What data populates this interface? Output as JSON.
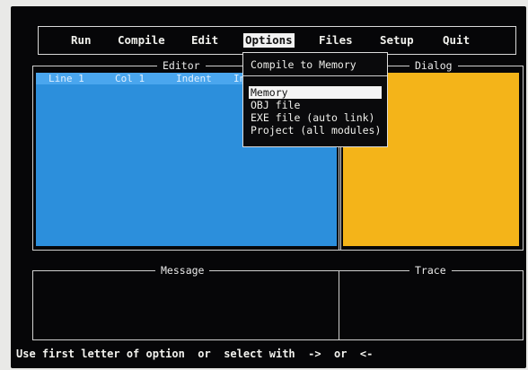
{
  "menu": {
    "items": [
      {
        "label": "Run"
      },
      {
        "label": "Compile"
      },
      {
        "label": "Edit"
      },
      {
        "label": "Options"
      },
      {
        "label": "Files"
      },
      {
        "label": "Setup"
      },
      {
        "label": "Quit"
      }
    ],
    "active_index": 3
  },
  "editor": {
    "title": "Editor",
    "status": {
      "line": "Line 1",
      "col": "Col 1",
      "indent": "Indent",
      "insert": "Ins"
    },
    "fill_color": "#2c8fdc"
  },
  "dialog": {
    "title": "Dialog",
    "fill_color": "#f4b419"
  },
  "message": {
    "title": "Message"
  },
  "trace": {
    "title": "Trace"
  },
  "dropdown": {
    "title": "Compile to Memory",
    "items": [
      {
        "label": "Memory",
        "selected": true
      },
      {
        "label": "OBJ file",
        "selected": false
      },
      {
        "label": "EXE file (auto link)",
        "selected": false
      },
      {
        "label": "Project (all modules)",
        "selected": false
      }
    ]
  },
  "status_line": "Use first letter of option  or  select with  ->  or  <-"
}
